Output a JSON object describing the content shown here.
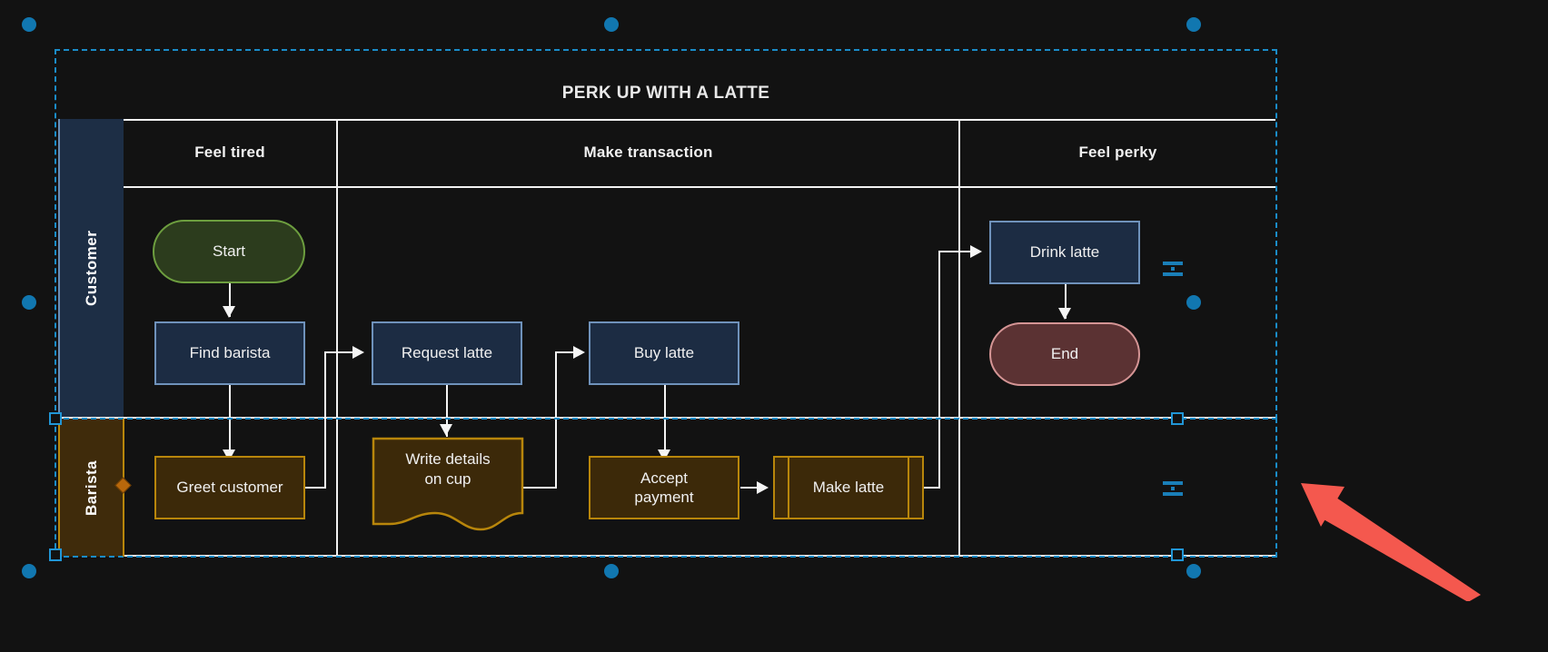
{
  "app": {
    "canvas_background": "#121212",
    "selection_color": "#1a8cc8"
  },
  "diagram": {
    "title": "PERK UP WITH A LATTE",
    "type": "cross-functional-flowchart",
    "lanes": [
      {
        "id": "customer",
        "label": "Customer",
        "fill": "#1d2e45",
        "stroke": "#6a8db5",
        "selected": false
      },
      {
        "id": "barista",
        "label": "Barista",
        "fill": "#3f2b0b",
        "stroke": "#b8860b",
        "selected": true
      }
    ],
    "phases": [
      {
        "id": "phase-1",
        "label": "Feel tired"
      },
      {
        "id": "phase-2",
        "label": "Make transaction"
      },
      {
        "id": "phase-3",
        "label": "Feel perky"
      }
    ],
    "nodes": [
      {
        "id": "start",
        "label": "Start",
        "shape": "terminator",
        "lane": "customer",
        "phase": "phase-1",
        "fill": "#2c3c1d",
        "stroke": "#6d9e3f"
      },
      {
        "id": "find-barista",
        "label": "Find barista",
        "shape": "process",
        "lane": "customer",
        "phase": "phase-1",
        "fill": "#1c2c43",
        "stroke": "#6f92bb"
      },
      {
        "id": "request-latte",
        "label": "Request latte",
        "shape": "process",
        "lane": "customer",
        "phase": "phase-2",
        "fill": "#1c2c43",
        "stroke": "#6f92bb"
      },
      {
        "id": "buy-latte",
        "label": "Buy latte",
        "shape": "process",
        "lane": "customer",
        "phase": "phase-2",
        "fill": "#1c2c43",
        "stroke": "#6f92bb"
      },
      {
        "id": "drink-latte",
        "label": "Drink latte",
        "shape": "process",
        "lane": "customer",
        "phase": "phase-3",
        "fill": "#1c2c43",
        "stroke": "#6f92bb"
      },
      {
        "id": "end",
        "label": "End",
        "shape": "terminator",
        "lane": "customer",
        "phase": "phase-3",
        "fill": "#5b3233",
        "stroke": "#d59595"
      },
      {
        "id": "greet-customer",
        "label": "Greet customer",
        "shape": "process",
        "lane": "barista",
        "phase": "phase-1",
        "fill": "#3c2909",
        "stroke": "#b8860b"
      },
      {
        "id": "write-details",
        "label": "Write details\non cup",
        "label_line_1": "Write details",
        "label_line_2": "on cup",
        "shape": "document",
        "lane": "barista",
        "phase": "phase-2",
        "fill": "#3c2909",
        "stroke": "#b8860b"
      },
      {
        "id": "accept-payment",
        "label": "Accept\npayment",
        "label_line_1": "Accept",
        "label_line_2": "payment",
        "shape": "process",
        "lane": "barista",
        "phase": "phase-2",
        "fill": "#3c2909",
        "stroke": "#b8860b"
      },
      {
        "id": "make-latte",
        "label": "Make latte",
        "shape": "predefined-process",
        "lane": "barista",
        "phase": "phase-2",
        "fill": "#3c2909",
        "stroke": "#b8860b"
      }
    ],
    "edges": [
      {
        "from": "start",
        "to": "find-barista"
      },
      {
        "from": "find-barista",
        "to": "greet-customer"
      },
      {
        "from": "greet-customer",
        "to": "request-latte"
      },
      {
        "from": "request-latte",
        "to": "write-details"
      },
      {
        "from": "write-details",
        "to": "buy-latte"
      },
      {
        "from": "buy-latte",
        "to": "accept-payment"
      },
      {
        "from": "accept-payment",
        "to": "make-latte"
      },
      {
        "from": "make-latte",
        "to": "drink-latte"
      },
      {
        "from": "drink-latte",
        "to": "end"
      }
    ]
  },
  "selection": {
    "target_lane": "Barista",
    "handles": {
      "corner_square": "resize-handle",
      "side_bars": "lane-size-handle",
      "diamond": "lane-label-handle",
      "dot": "rotate-handle"
    }
  },
  "annotation": {
    "arrow_color": "#f4584e",
    "points_to": "lane-size-handle"
  }
}
